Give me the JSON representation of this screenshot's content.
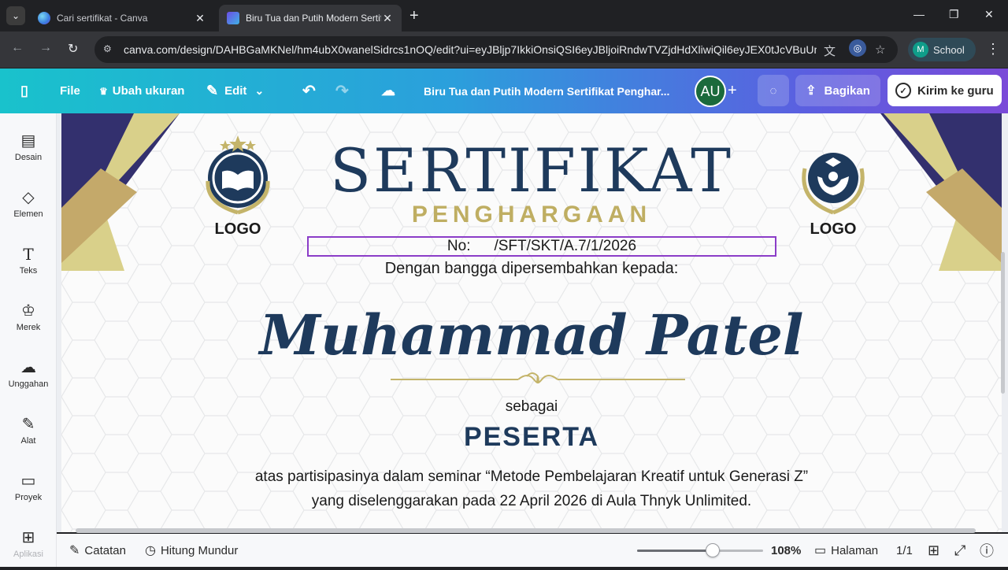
{
  "browser": {
    "tabs": [
      {
        "title": "Cari sertifikat - Canva",
        "active": false,
        "icon": "canva-favicon-icon"
      },
      {
        "title": "Biru Tua dan Putih Modern Sertifikat Penghargaan",
        "active": true,
        "icon": "canva-design-favicon-icon"
      }
    ],
    "url": "canva.com/design/DAHBGaMKNel/hm4ubX0wanelSidrcs1nOQ/edit?ui=eyJBljp7IkkiOnsiQSI6eyJBljoiRndwTVZjdHdXliwiQil6eyJEX0tJcVBuUm...",
    "profile": {
      "initial": "M",
      "label": "School"
    }
  },
  "header": {
    "file_label": "File",
    "resize_label": "Ubah ukuran",
    "edit_label": "Edit",
    "design_title": "Biru Tua dan Putih Modern Sertifikat Penghar...",
    "avatar_initials": "AU",
    "share_label": "Bagikan",
    "submit_label": "Kirim ke guru"
  },
  "sidebar": {
    "items": [
      {
        "label": "Desain",
        "icon": "layout-icon",
        "glyph": "▤"
      },
      {
        "label": "Elemen",
        "icon": "shapes-icon",
        "glyph": "◇"
      },
      {
        "label": "Teks",
        "icon": "text-icon",
        "glyph": "T"
      },
      {
        "label": "Merek",
        "icon": "brand-icon",
        "glyph": "♔"
      },
      {
        "label": "Unggahan",
        "icon": "upload-cloud-icon",
        "glyph": "☁"
      },
      {
        "label": "Alat",
        "icon": "draw-pen-icon",
        "glyph": "✎"
      },
      {
        "label": "Proyek",
        "icon": "folder-icon",
        "glyph": "▭"
      },
      {
        "label": "Aplikasi",
        "icon": "apps-grid-icon",
        "glyph": "⊞"
      }
    ]
  },
  "certificate": {
    "title": "SERTIFIKAT",
    "subtitle": "PENGHARGAAN",
    "logo_left_label": "LOGO",
    "logo_right_label": "LOGO",
    "number_label": "No:",
    "number_value": "/SFT/SKT/A.7/1/2026",
    "presented_to": "Dengan bangga dipersembahkan kepada:",
    "recipient": "Muhammad Patel",
    "as_label": "sebagai",
    "role": "PESERTA",
    "description_line1": "atas partisipasinya dalam seminar “Metode Pembelajaran Kreatif untuk Generasi Z”",
    "description_line2": "yang diselenggarakan pada 22 April 2026 di Aula Thnyk Unlimited.",
    "colors": {
      "navy": "#1e3a5c",
      "gold": "#bfae62",
      "selection": "#8b3dc8"
    }
  },
  "footer": {
    "notes_label": "Catatan",
    "timer_label": "Hitung Mundur",
    "zoom": "108%",
    "zoom_fraction": 0.6,
    "pages_label": "Halaman",
    "page_count": "1/1"
  }
}
